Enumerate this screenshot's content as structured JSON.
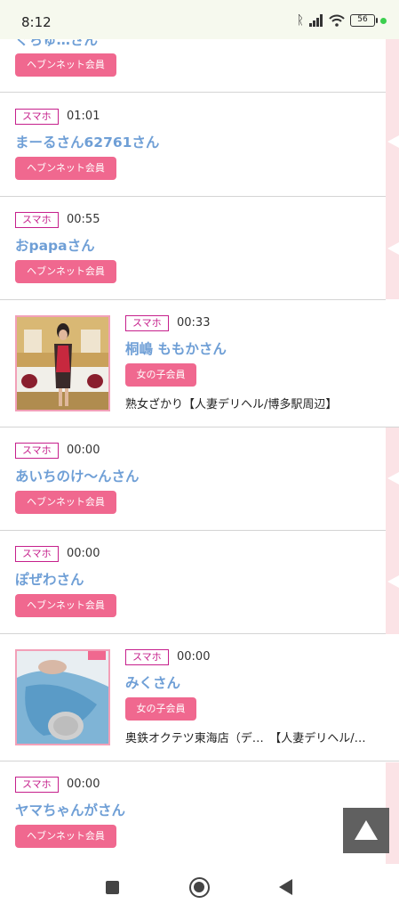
{
  "status_bar": {
    "time": "8:12",
    "battery": "56"
  },
  "entries": [
    {
      "name": "ぐちゅ…さん",
      "badge": "ヘブンネット会員"
    },
    {
      "device": "スマホ",
      "time": "01:01",
      "name": "まーるさん62761さん",
      "badge": "ヘブンネット会員"
    },
    {
      "device": "スマホ",
      "time": "00:55",
      "name": "おpapaさん",
      "badge": "ヘブンネット会員"
    },
    {
      "device": "スマホ",
      "time": "00:33",
      "name": "桐嶋 ももかさん",
      "badge": "女の子会員",
      "shop": "熟女ざかり【人妻デリヘル/博多駅周辺】"
    },
    {
      "device": "スマホ",
      "time": "00:00",
      "name": "あいちのけ〜んさん",
      "badge": "ヘブンネット会員"
    },
    {
      "device": "スマホ",
      "time": "00:00",
      "name": "ぽぜわさん",
      "badge": "ヘブンネット会員"
    },
    {
      "device": "スマホ",
      "time": "00:00",
      "name": "みくさん",
      "badge": "女の子会員",
      "shop": "奥鉄オクテツ東海店（デ…　【人妻デリヘル/…"
    },
    {
      "device": "スマホ",
      "time": "00:00",
      "name": "ヤマちゃんがさん",
      "badge": "ヘブンネット会員"
    }
  ],
  "colors": {
    "accent_pink": "#f0688f",
    "name_blue": "#6f9fd6",
    "device_magenta": "#c6208c",
    "strip_pink": "#fbe3e6"
  },
  "icons": [
    "bluetooth-icon",
    "signal-icon",
    "wifi-icon",
    "battery-icon",
    "scroll-to-top-icon",
    "recent-apps-icon",
    "home-icon",
    "back-icon"
  ]
}
